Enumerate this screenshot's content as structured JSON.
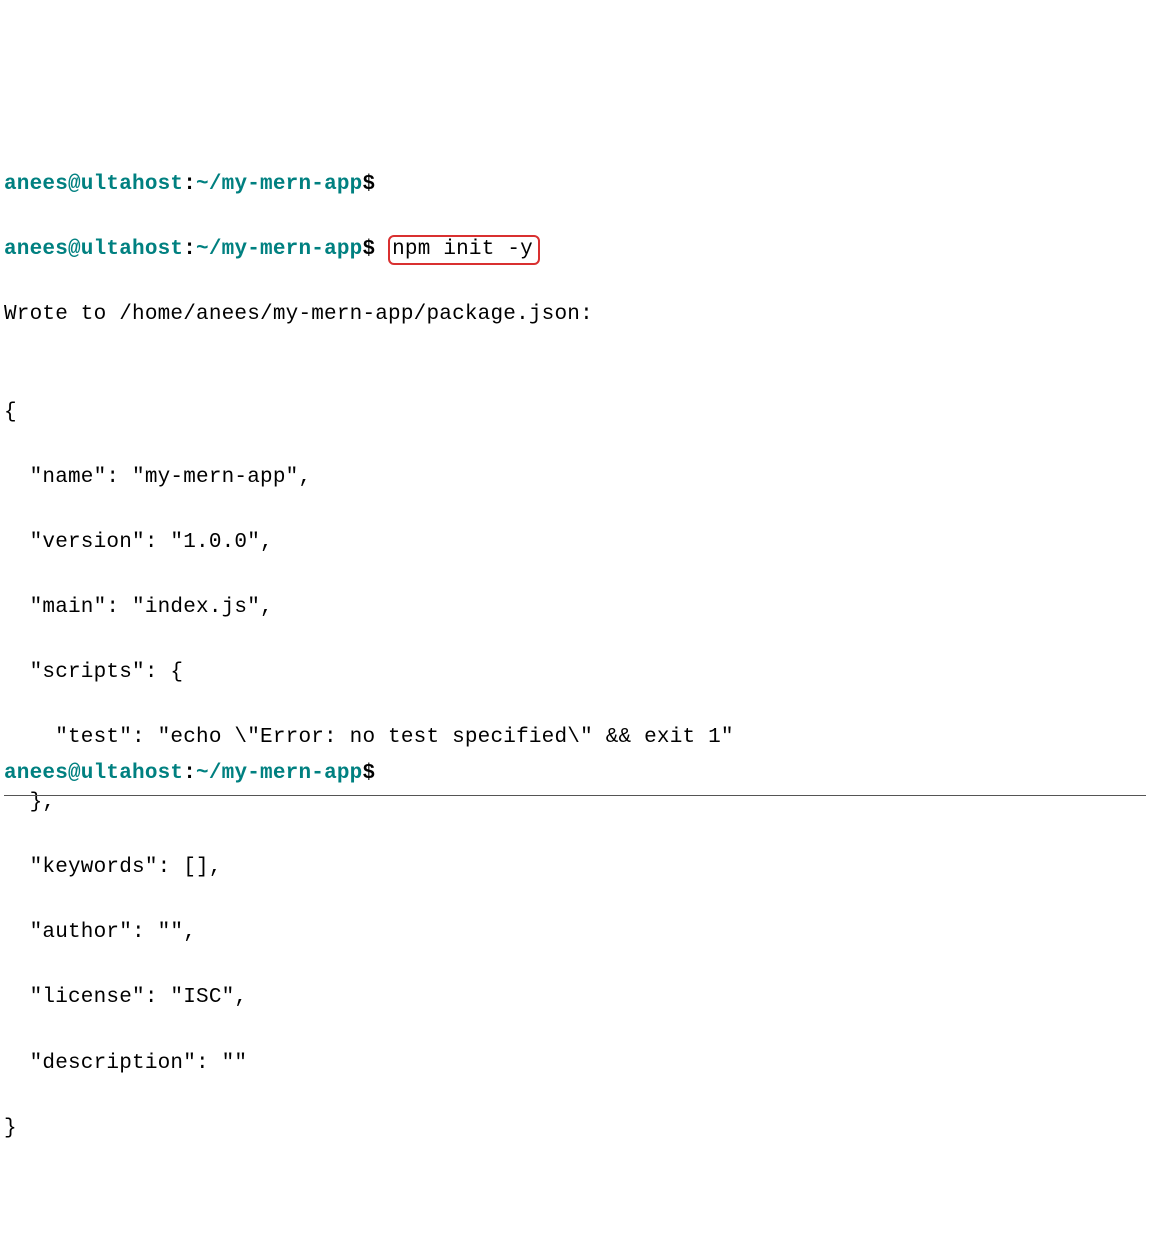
{
  "prompt": {
    "user": "anees@ultahost",
    "colon": ":",
    "path": "~/my-mern-app",
    "dollar": "$"
  },
  "command": "npm init -y",
  "output": {
    "wrote_line": "Wrote to /home/anees/my-mern-app/package.json:",
    "blank": "",
    "json_open": "{",
    "name_line": "  \"name\": \"my-mern-app\",",
    "version_line": "  \"version\": \"1.0.0\",",
    "main_line": "  \"main\": \"index.js\",",
    "scripts_open": "  \"scripts\": {",
    "test_line": "    \"test\": \"echo \\\"Error: no test specified\\\" && exit 1\"",
    "scripts_close": "  },",
    "keywords_line": "  \"keywords\": [],",
    "author_line": "  \"author\": \"\",",
    "license_line": "  \"license\": \"ISC\",",
    "description_line": "  \"description\": \"\"",
    "json_close": "}"
  }
}
